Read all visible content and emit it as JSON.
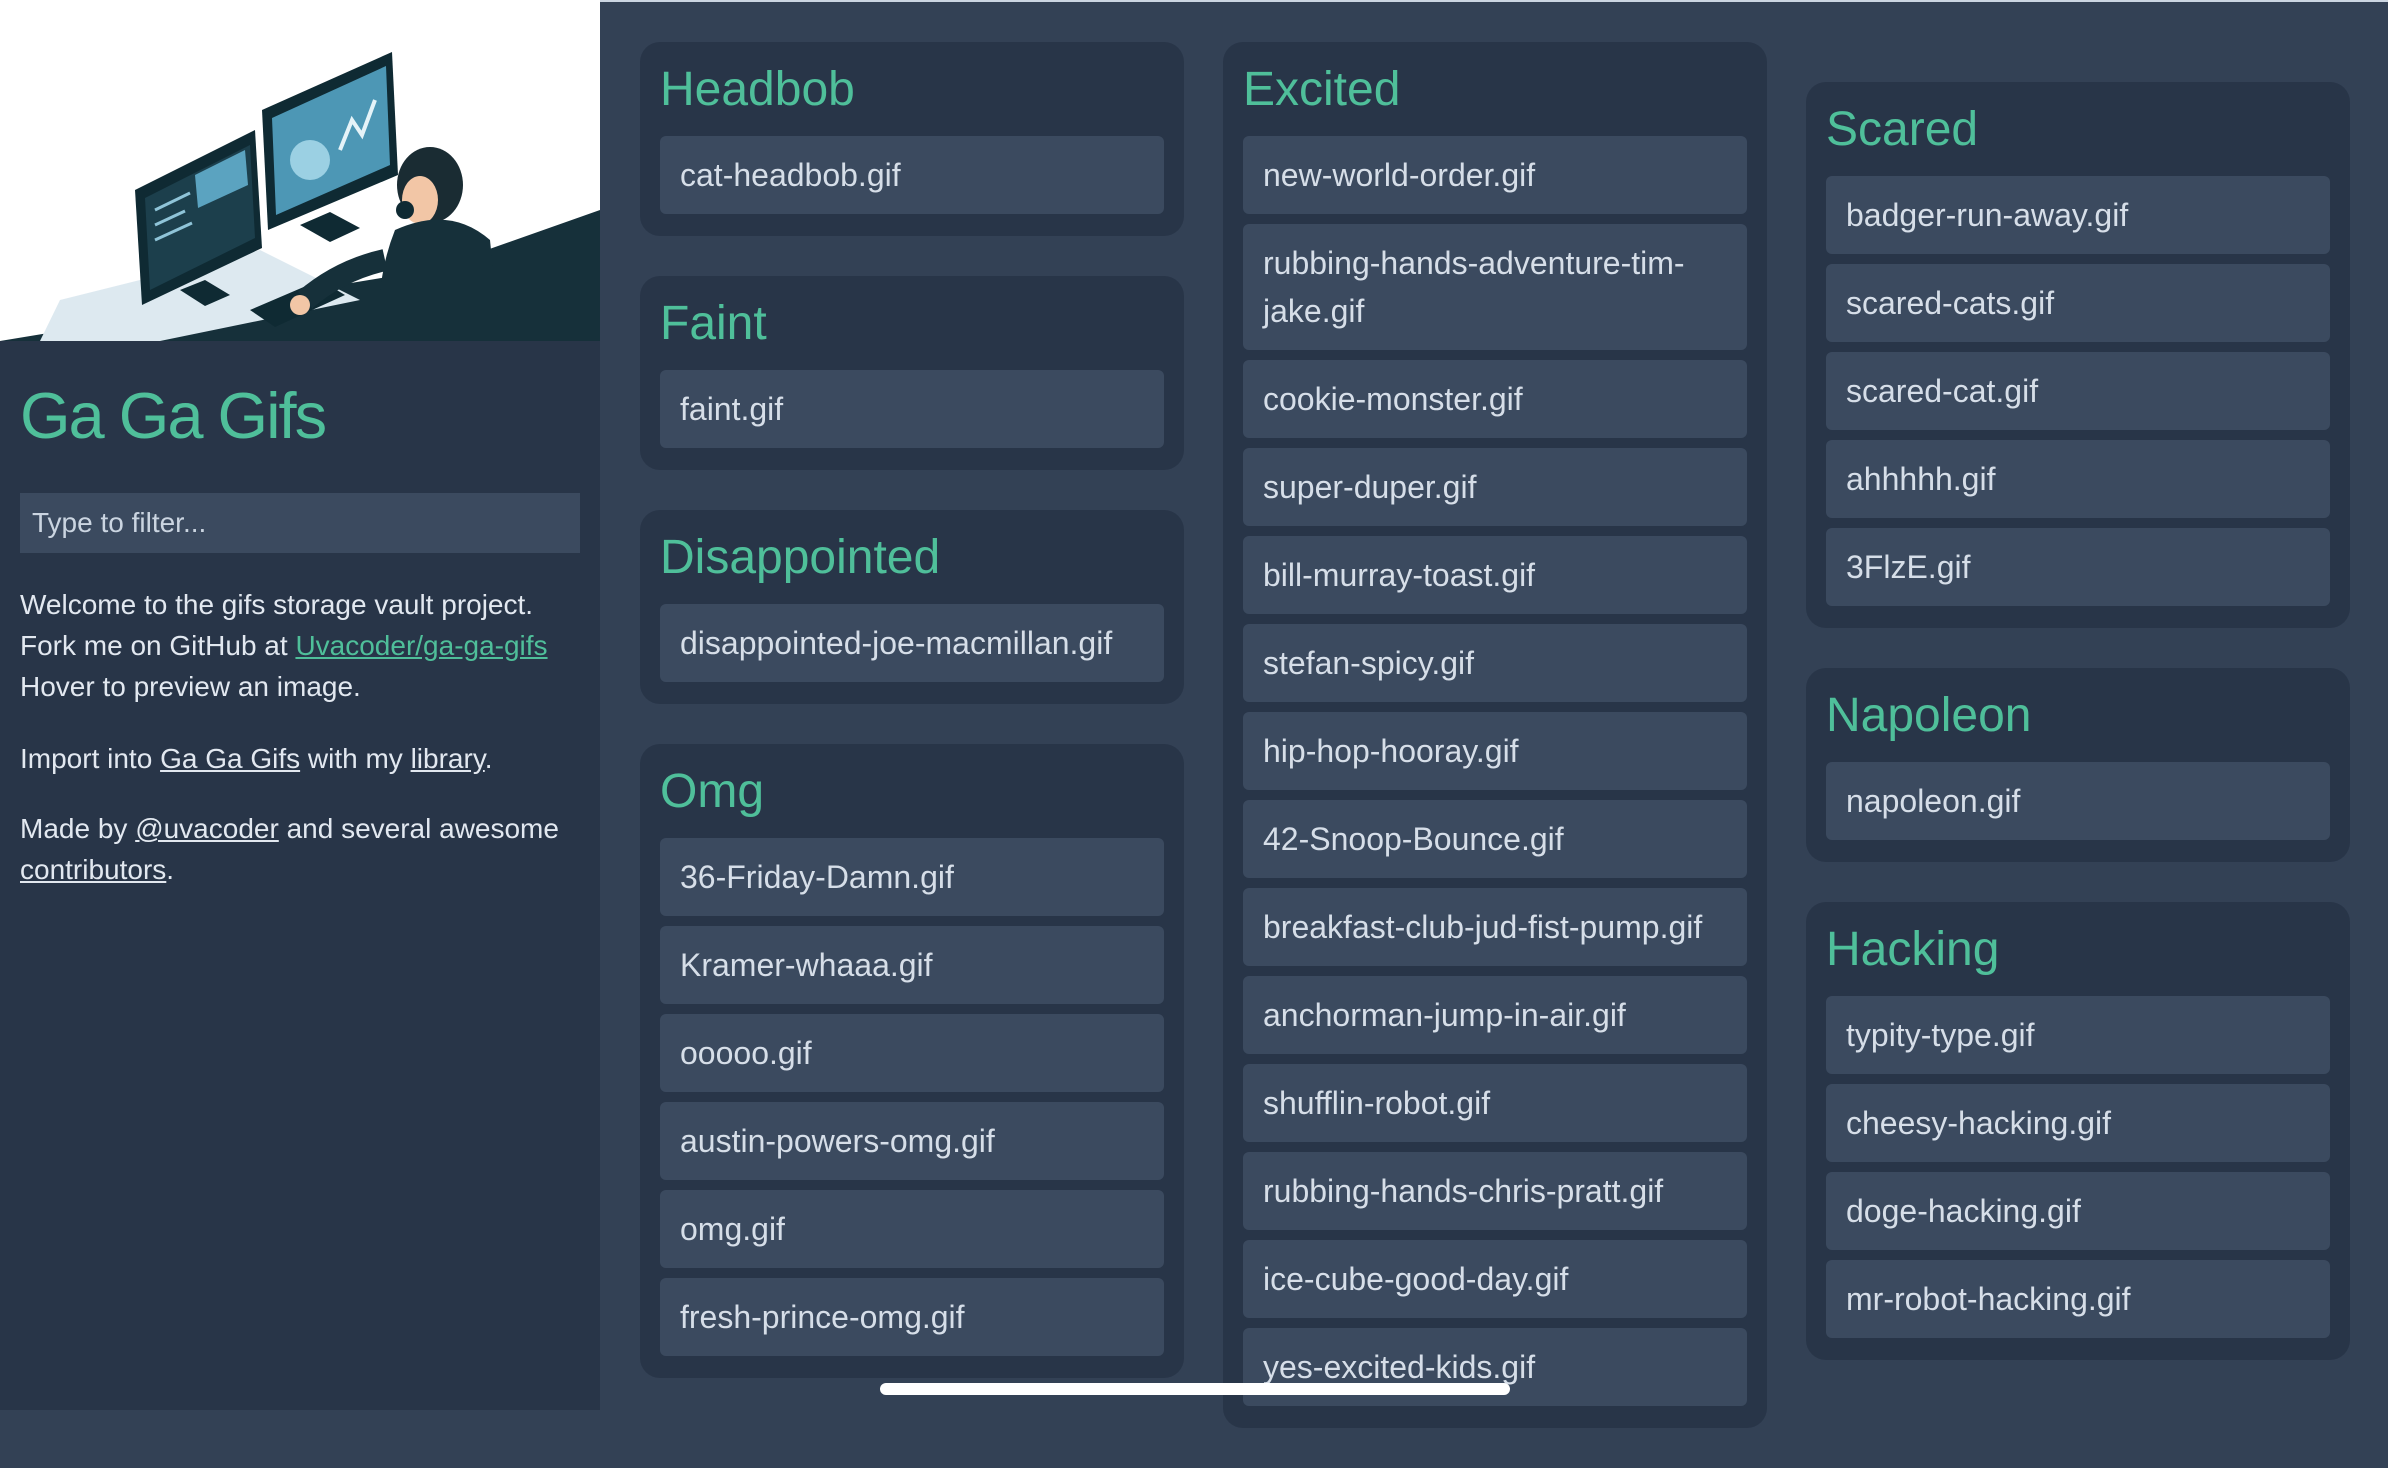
{
  "sidebar": {
    "title": "Ga Ga Gifs",
    "filter_placeholder": "Type to filter...",
    "intro": {
      "welcome": "Welcome to the gifs storage vault project.",
      "fork_prefix": "Fork me on GitHub at",
      "fork_link": "Uvacoder/ga-ga-gifs",
      "hover": "Hover to preview an image."
    },
    "import": {
      "prefix": "Import into",
      "link1": "Ga Ga Gifs",
      "middle": "with my",
      "link2": "library",
      "suffix": "."
    },
    "made": {
      "prefix": "Made by",
      "link1": "@uvacoder",
      "middle": "and several awesome",
      "link2": "contributors",
      "suffix": "."
    }
  },
  "categories": {
    "headbob": {
      "title": "Headbob",
      "items": [
        "cat-headbob.gif"
      ]
    },
    "faint": {
      "title": "Faint",
      "items": [
        "faint.gif"
      ]
    },
    "disappointed": {
      "title": "Disappointed",
      "items": [
        "disappointed-joe-macmillan.gif"
      ]
    },
    "omg": {
      "title": "Omg",
      "items": [
        "36-Friday-Damn.gif",
        "Kramer-whaaa.gif",
        "ooooo.gif",
        "austin-powers-omg.gif",
        "omg.gif",
        "fresh-prince-omg.gif"
      ]
    },
    "excited": {
      "title": "Excited",
      "items": [
        "new-world-order.gif",
        "rubbing-hands-adventure-tim-jake.gif",
        "cookie-monster.gif",
        "super-duper.gif",
        "bill-murray-toast.gif",
        "stefan-spicy.gif",
        "hip-hop-hooray.gif",
        "42-Snoop-Bounce.gif",
        "breakfast-club-jud-fist-pump.gif",
        "anchorman-jump-in-air.gif",
        "shufflin-robot.gif",
        "rubbing-hands-chris-pratt.gif",
        "ice-cube-good-day.gif",
        "yes-excited-kids.gif"
      ]
    },
    "scared": {
      "title": "Scared",
      "items": [
        "badger-run-away.gif",
        "scared-cats.gif",
        "scared-cat.gif",
        "ahhhhh.gif",
        "3FlzE.gif"
      ]
    },
    "napoleon": {
      "title": "Napoleon",
      "items": [
        "napoleon.gif"
      ]
    },
    "hacking": {
      "title": "Hacking",
      "items": [
        "typity-type.gif",
        "cheesy-hacking.gif",
        "doge-hacking.gif",
        "mr-robot-hacking.gif"
      ]
    }
  },
  "colors": {
    "accent": "#4fbf9a",
    "background": "#334155",
    "card": "#283548",
    "item": "#3b4a5f"
  }
}
